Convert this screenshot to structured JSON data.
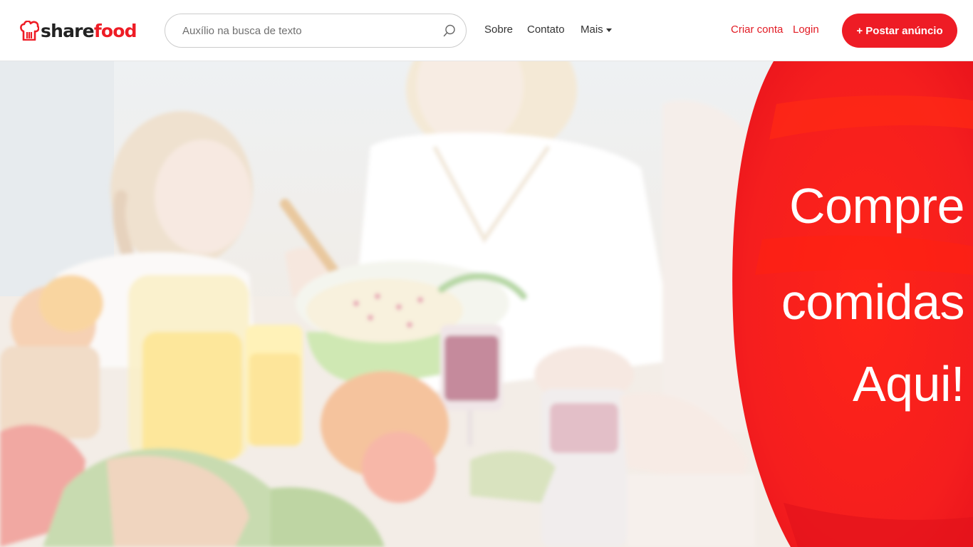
{
  "header": {
    "logo": {
      "share": "share",
      "food": "food"
    },
    "search": {
      "placeholder": "Auxílio na busca de texto"
    },
    "nav": {
      "sobre": "Sobre",
      "contato": "Contato",
      "mais": "Mais"
    },
    "auth": {
      "criar_conta": "Criar conta",
      "login": "Login"
    },
    "post_button": "+ Postar anúncio"
  },
  "hero": {
    "line1": "Compre",
    "line2": "comidas",
    "line3": "Aqui!"
  },
  "colors": {
    "brand_red": "#ee1c25",
    "text_dark": "#333333",
    "link_red": "#e21b24"
  },
  "icons": [
    "chef-hat-logo-icon",
    "search-icon",
    "caret-down-icon"
  ]
}
